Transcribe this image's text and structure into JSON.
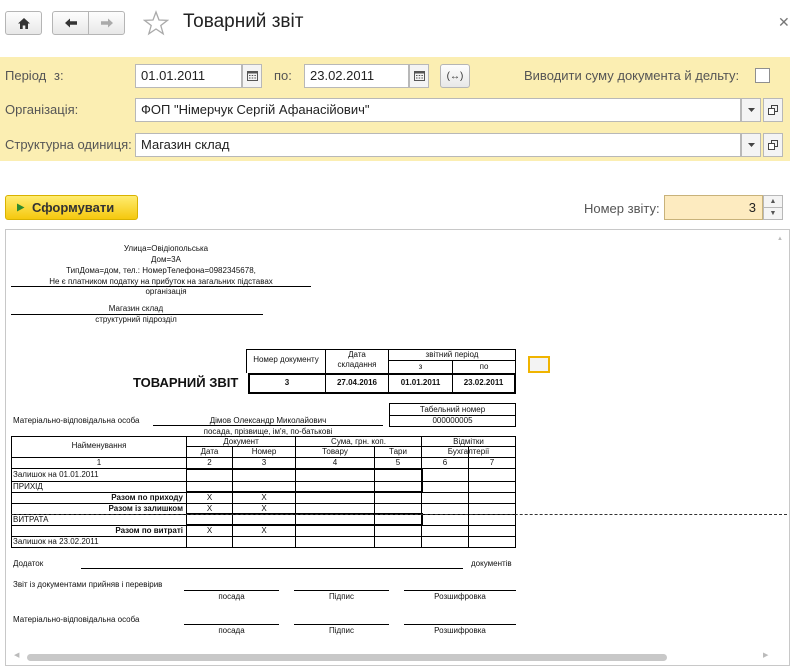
{
  "window": {
    "title": "Товарний звіт"
  },
  "filters": {
    "period_label": "Період",
    "from_label": "з:",
    "date_from": "01.01.2011",
    "to_label": "по:",
    "date_to": "23.02.2011",
    "period_btn": "(↔)",
    "show_sum_label": "Виводити суму документа й дельту:",
    "show_sum_checked": false,
    "org_label": "Організація:",
    "org_value": "ФОП \"Німерчук Сергій Афанасійович\"",
    "unit_label": "Структурна одиниця:",
    "unit_value": "Магазин склад"
  },
  "actions": {
    "generate_label": "Сформувати",
    "report_no_label": "Номер звіту:",
    "report_no_value": "3"
  },
  "report": {
    "addr1": "Улица=Овідіопольська",
    "addr2": "Дом=3А",
    "addr3": "ТипДома=дом,  тел.: НомерТелефона=0982345678,",
    "addr4": "Не є платником податку на прибуток на загальних підставах",
    "org_caption": "організація",
    "unit_value": "Магазин склад",
    "unit_caption": "структурний підрозділ",
    "title": "ТОВАРНИЙ ЗВІТ",
    "hdr_doc_no": "Номер документу",
    "hdr_date1": "Дата",
    "hdr_date2": "складання",
    "hdr_period": "звітний період",
    "hdr_from": "з",
    "hdr_to": "по",
    "doc_no": "3",
    "doc_date": "27.04.2016",
    "period_from": "01.01.2011",
    "period_to": "23.02.2011",
    "mvo_label": "Матеріально-відповідальна особа",
    "mvo_name": "Дімов Олександр Миколайович",
    "mvo_caption": "посада, прізвище, ім'я, по-батькові",
    "tab_label": "Табельний номер",
    "tab_value": "000000005",
    "col_name": "Найменування",
    "col_doc": "Документ",
    "col_sum": "Сума, грн. коп.",
    "col_marks": "Відмітки",
    "col_date": "Дата",
    "col_number": "Номер",
    "col_goods": "Товару",
    "col_tare": "Тари",
    "col_acc": "Бухгалтерії",
    "colnums": [
      "1",
      "2",
      "3",
      "4",
      "5",
      "6",
      "7"
    ],
    "row_balance_start": "Залишок на 01.01.2011",
    "row_income": "ПРИХІД",
    "row_total_income": "Разом по приходу",
    "row_total_with_balance": "Разом із залишком",
    "row_expense": "ВИТРАТА",
    "row_total_expense": "Разом по витраті",
    "row_balance_end": "Залишок на 23.02.2011",
    "x_mark": "X",
    "appendix_label": "Додаток",
    "documents_label": "документів",
    "accepted_label": "Звіт із документами прийняв і перевірив",
    "sig_position": "посада",
    "sig_signature": "Підпис",
    "sig_decode": "Розшифровка",
    "mvo_label2": "Матеріально-відповідальна особа"
  }
}
